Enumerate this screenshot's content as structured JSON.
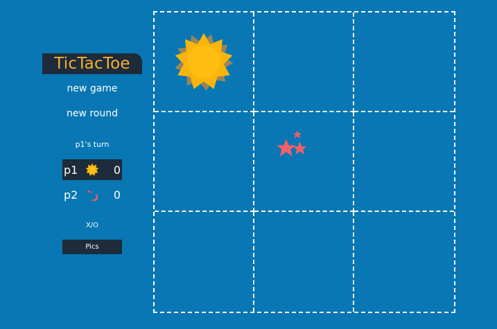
{
  "sidebar": {
    "logo": "TicTacToe",
    "new_game": "new game",
    "new_round": "new round",
    "turn_text": "p1's turn",
    "players": [
      {
        "name": "p1",
        "icon": "sun-icon",
        "score": "0",
        "active": true
      },
      {
        "name": "p2",
        "icon": "moon-stars-icon",
        "score": "0",
        "active": false
      }
    ],
    "mode_label": "X/O",
    "mode_button": "Pics"
  },
  "board": {
    "cells": [
      "sun",
      "",
      "",
      "",
      "moon",
      "",
      "",
      "",
      ""
    ]
  },
  "colors": {
    "background": "#0877b3",
    "panel": "#1d2b3a",
    "logo_text": "#f6b031",
    "sun": "#f9b50b",
    "moon": "#f26067"
  }
}
